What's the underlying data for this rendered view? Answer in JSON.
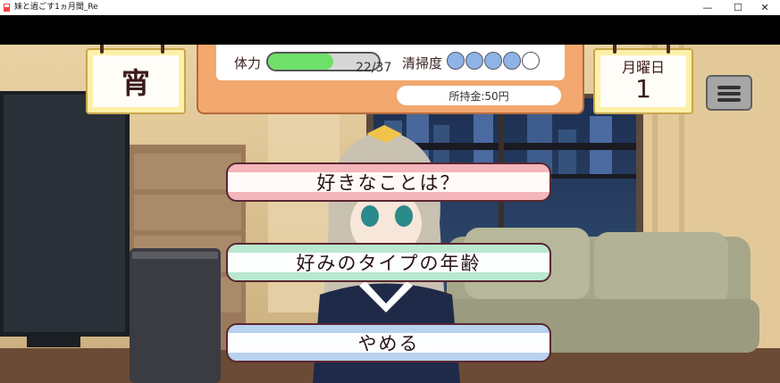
{
  "window": {
    "title": "妹と過ごす1ヵ月間_Re",
    "controls": [
      "—",
      "☐",
      "✕"
    ]
  },
  "hud": {
    "stamina_label": "体力",
    "stamina_text": "22/37",
    "stamina_fraction": 0.59,
    "cleaning_label": "清掃度",
    "cleaning_filled": 4,
    "cleaning_total": 5,
    "money_text": "所持金:50円"
  },
  "calendar_left": {
    "text": "宵"
  },
  "calendar_right": {
    "weekday": "月曜日",
    "day": "1"
  },
  "choices": [
    {
      "label": "好きなことは？"
    },
    {
      "label": "好みのタイプの年齢"
    },
    {
      "label": "やめる"
    }
  ],
  "colors": {
    "hud_orange": "#f2a86e",
    "stamina_green": "#6fe06a",
    "cleaning_blue": "#8fb3e6",
    "choice_pink": "#f4b6ba",
    "choice_green": "#b9e8cf",
    "choice_blue": "#b8d2ee",
    "calendar_yellow": "#fdf0a8"
  },
  "icons": {
    "menu": "hamburger-icon",
    "app": "app-icon"
  }
}
